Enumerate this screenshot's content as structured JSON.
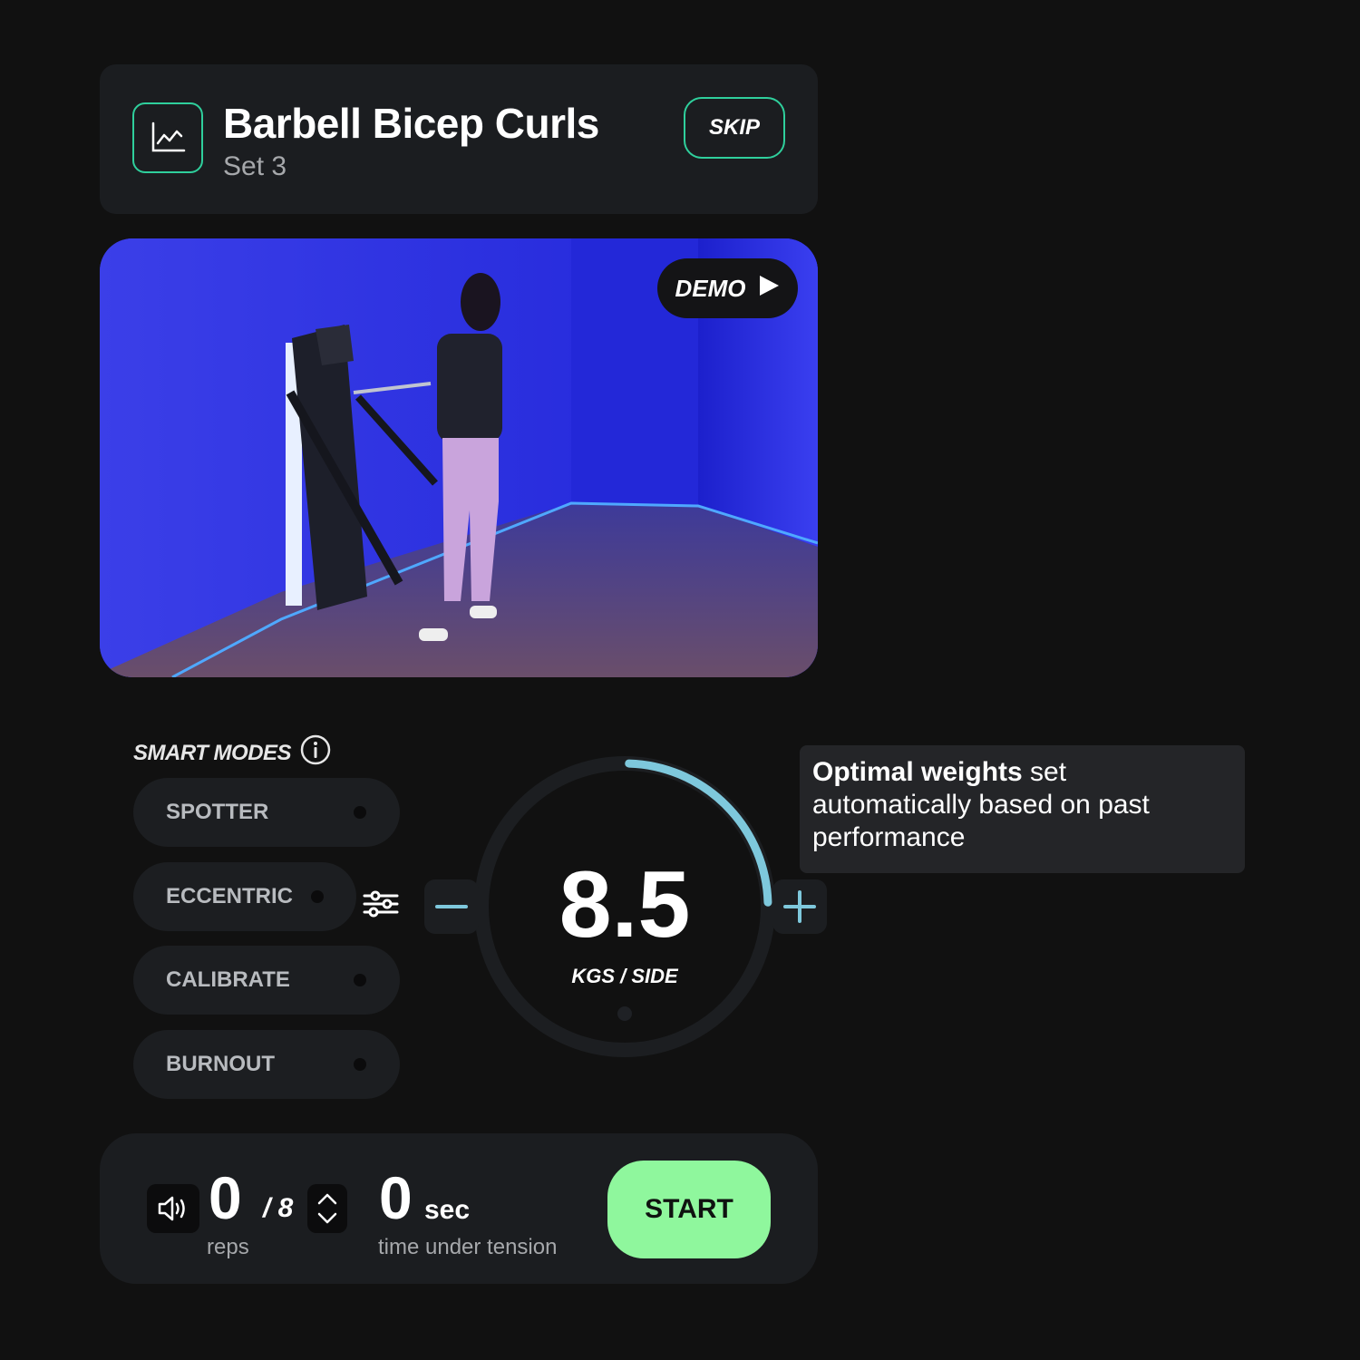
{
  "colors": {
    "background": "#111111",
    "card": "#1b1d20",
    "accent_green": "#2fcf9c",
    "dial_arc": "#7ec8dc",
    "start_button": "#8ff79d"
  },
  "header": {
    "icon": "line-chart-icon",
    "title": "Barbell Bicep Curls",
    "subtitle": "Set 3",
    "skip_label": "SKIP"
  },
  "video": {
    "demo_label": "DEMO",
    "demo_icon": "play-icon"
  },
  "smart_modes": {
    "label": "SMART MODES",
    "info_icon": "info-icon",
    "modes": [
      {
        "label": "SPOTTER"
      },
      {
        "label": "ECCENTRIC"
      },
      {
        "label": "CALIBRATE"
      },
      {
        "label": "BURNOUT"
      }
    ],
    "settings_icon": "sliders-icon"
  },
  "weight": {
    "value": "8.5",
    "unit": "KGS / SIDE",
    "progress_fraction": 0.25,
    "minus_icon": "minus-icon",
    "plus_icon": "plus-icon"
  },
  "tooltip": {
    "bold": "Optimal weights",
    "text": " set automatically based on past performance"
  },
  "bottom": {
    "sound_icon": "speaker-icon",
    "reps_value": "0",
    "reps_total": "/ 8",
    "reps_label": "reps",
    "stepper_icon": "chevron-up-down-icon",
    "tension_value": "0",
    "tension_unit": "sec",
    "tension_label": "time under tension",
    "start_label": "START"
  }
}
